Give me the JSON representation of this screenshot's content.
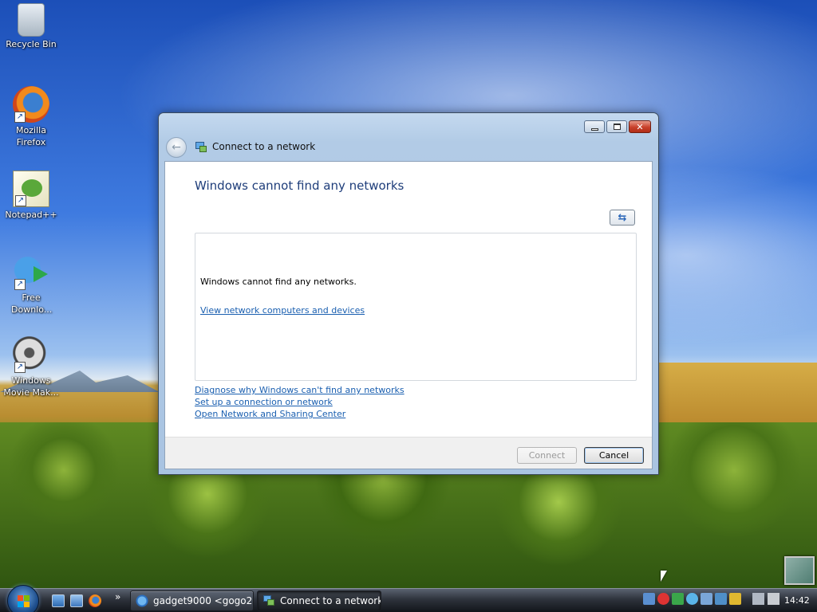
{
  "desktop": {
    "icons": [
      {
        "label": "Recycle Bin",
        "icon": "recycle-bin-icon"
      },
      {
        "label": "Mozilla Firefox",
        "icon": "firefox-icon"
      },
      {
        "label": "Notepad++",
        "icon": "notepad-plus-plus-icon"
      },
      {
        "label": "Free Downlo...",
        "icon": "free-download-manager-icon"
      },
      {
        "label": "Windows Movie Mak...",
        "icon": "windows-movie-maker-icon"
      }
    ]
  },
  "window": {
    "title": "Connect to a network",
    "heading": "Windows cannot find any networks",
    "list_message": "Windows cannot find any networks.",
    "list_link": "View network computers and devices",
    "links": [
      "Diagnose why Windows can't find any networks",
      "Set up a connection or network",
      "Open Network and Sharing Center"
    ],
    "buttons": {
      "connect": "Connect",
      "cancel": "Cancel"
    }
  },
  "taskbar": {
    "chevron": "»",
    "tasks": [
      {
        "label": "gadget9000 <gogo2...",
        "active": false
      },
      {
        "label": "Connect to a network",
        "active": true
      }
    ],
    "clock": "14:42"
  },
  "colors": {
    "heading": "#1e3d7a",
    "link": "#1a5fb0",
    "taskbar": "#2e333c"
  }
}
